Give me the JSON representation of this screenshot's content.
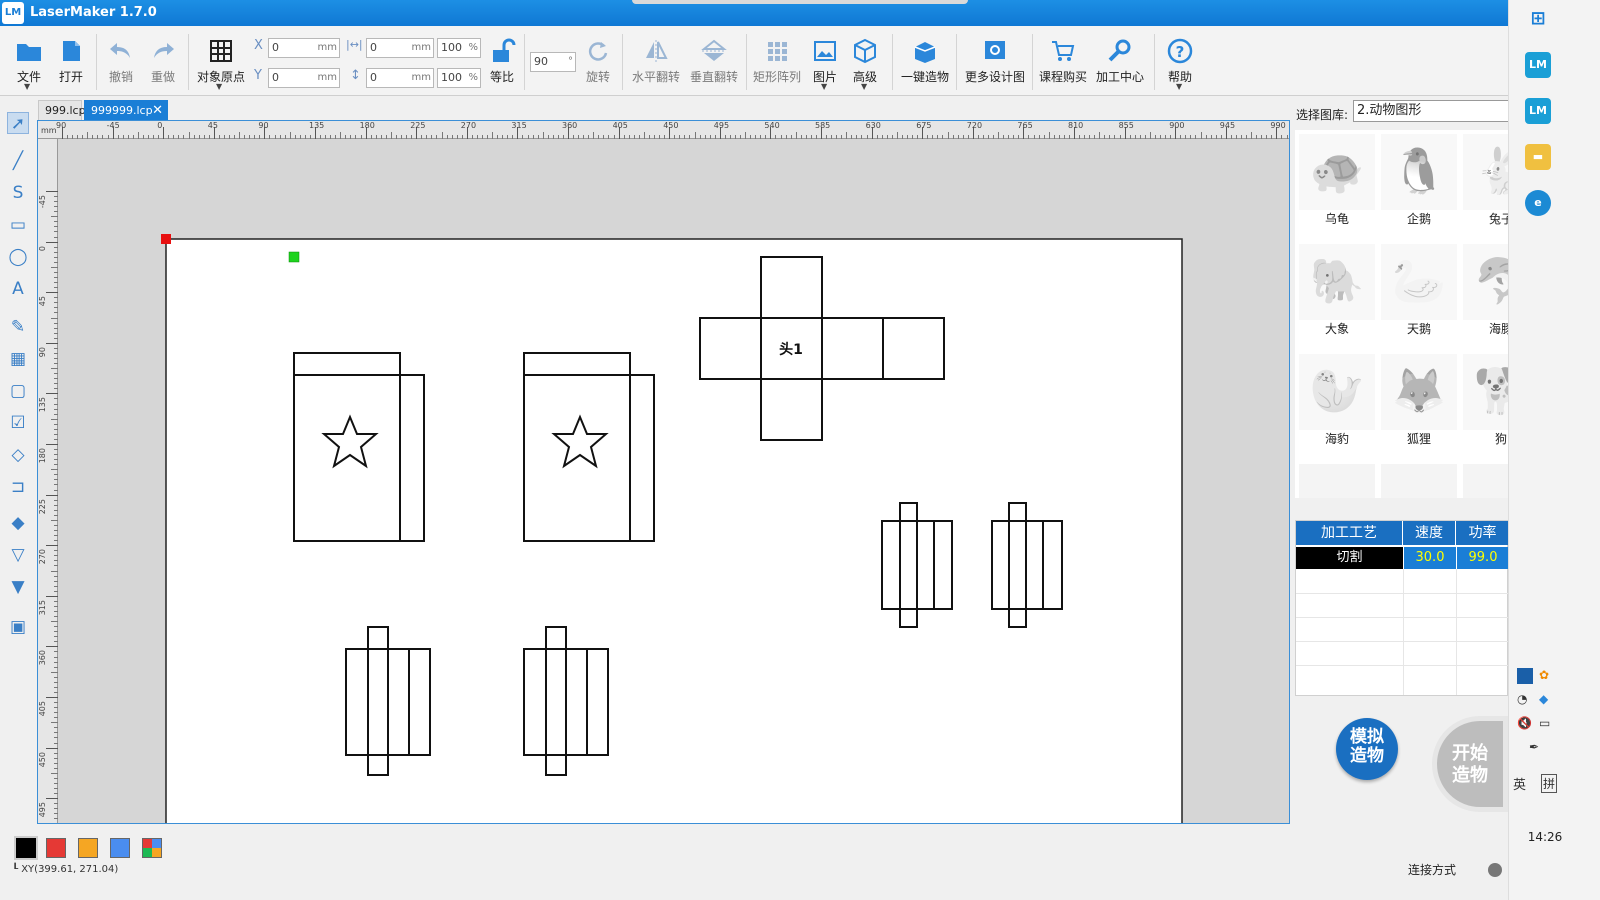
{
  "window": {
    "title": "LaserMaker 1.7.0"
  },
  "toolbar": {
    "file": "文件",
    "open": "打开",
    "undo": "撤销",
    "redo": "重做",
    "origin": "对象原点",
    "x_label": "X",
    "y_label": "Y",
    "x_value": "0",
    "y_value": "0",
    "w_value": "0",
    "h_value": "0",
    "unit": "mm",
    "w_scale": "100",
    "h_scale": "100",
    "pct": "%",
    "proportional": "等比",
    "rotate_value": "90",
    "deg": "°",
    "rotate": "旋转",
    "hflip": "水平翻转",
    "vflip": "垂直翻转",
    "array": "矩形阵列",
    "image": "图片",
    "advanced": "高级",
    "one_click": "一键造物",
    "more_designs": "更多设计图",
    "buy_course": "课程购买",
    "process_center": "加工中心",
    "help": "帮助"
  },
  "tabs": [
    {
      "label": "999.lcp",
      "active": false
    },
    {
      "label": "999999.lcp",
      "active": true
    }
  ],
  "canvas": {
    "ruler_unit": "mm",
    "ruler_top": [
      "90",
      "-45",
      "0",
      "45",
      "90",
      "135",
      "180",
      "225",
      "270",
      "315",
      "360",
      "405",
      "450",
      "495",
      "540",
      "585",
      "630",
      "675",
      "720",
      "765",
      "810",
      "855",
      "900",
      "945",
      "990"
    ],
    "ruler_left": [
      "-45",
      "0",
      "45",
      "90",
      "135",
      "180",
      "225",
      "270",
      "315",
      "360",
      "405",
      "450",
      "495"
    ],
    "text_mark": "头1"
  },
  "library": {
    "label": "选择图库:",
    "selected": "2.动物图形",
    "items": [
      {
        "name": "乌龟"
      },
      {
        "name": "企鹅"
      },
      {
        "name": "兔子"
      },
      {
        "name": "大象"
      },
      {
        "name": "天鹅"
      },
      {
        "name": "海豚"
      },
      {
        "name": "海豹"
      },
      {
        "name": "狐狸"
      },
      {
        "name": "狗"
      }
    ]
  },
  "process_table": {
    "headers": [
      "加工工艺",
      "速度",
      "功率"
    ],
    "rows": [
      {
        "process": "切割",
        "speed": "30.0",
        "power": "99.0"
      }
    ]
  },
  "actions": {
    "simulate": "模拟\n造物",
    "start": "开始\n造物"
  },
  "status": {
    "coords": "XY(399.61, 271.04)",
    "connection": "连接方式"
  },
  "colors": {
    "swatches": [
      "#000000",
      "#e53935",
      "#f5a623",
      "#4a8df0",
      "multi"
    ],
    "accent": "#1a7ed6"
  },
  "system": {
    "clock": "14:26",
    "ime_lang": "英",
    "ime_mode": "拼"
  }
}
